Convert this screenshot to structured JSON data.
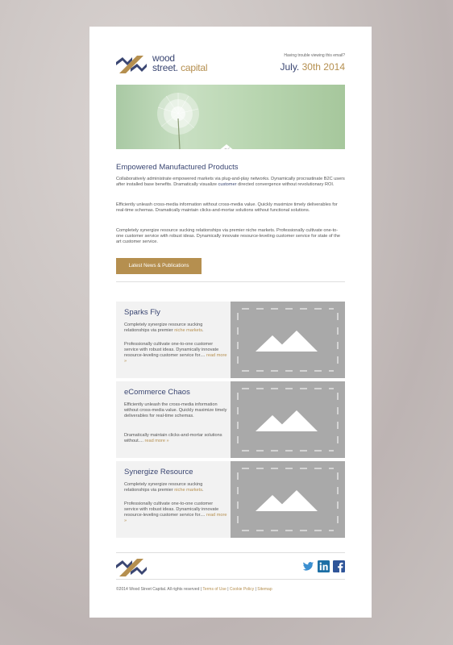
{
  "header": {
    "logo_line1": "wood",
    "logo_line2_a": "street.",
    "logo_line2_b": " capital",
    "trouble_link": "Having trouble viewing this email?",
    "date_month": "July.",
    "date_day": " 30th 2014"
  },
  "intro": {
    "heading": "Empowered Manufactured Products",
    "p1_a": "Collaboratively administrate empowered markets via plug-and-play networks. Dynamically procrastinate B2C users after installed base benefits. Dramatically visualize ",
    "p1_link": "customer",
    "p1_b": " directed convergence without revolutionary ROI.",
    "p2": "Efficiently unleash cross-media information without cross-media value. Quickly maximize timely deliverables for real-time schemas. Dramatically maintain clicks-and-mortar solutions without functional solutions.",
    "p3": "Completely synergize resource sucking relationships via premier niche markets. Professionally cultivate one-to-one customer service with robust ideas. Dynamically innovate resource-leveling customer service for state of the art customer service.",
    "button": "Latest News & Publications"
  },
  "articles": [
    {
      "title": "Sparks Fly",
      "t1_a": "Completely synergize resource sucking relationships via premier ",
      "t1_link": "niche markets",
      "t1_b": ".",
      "t2": "Professionally cultivate one-to-one customer service with robust ideas. Dynamically innovate resource-leveling customer service for.... ",
      "read_more": "read more »"
    },
    {
      "title": "eCommerce Chaos",
      "t1_a": "Efficiently unleash the cross-media information without cross-media value. Quickly maximize timely deliverables for real-time schemas.",
      "t1_link": "",
      "t1_b": "",
      "t2": "Dramatically maintain clicks-and-mortar solutions without.... ",
      "read_more": "read more »"
    },
    {
      "title": "Synergize Resource",
      "t1_a": "Completely synergize resource sucking relationships via premier ",
      "t1_link": "niche markets",
      "t1_b": ".",
      "t2": "Professionally cultivate one-to-one customer service with robust ideas. Dynamically innovate resource-leveling customer service for.... ",
      "read_more": "read more »"
    }
  ],
  "social": {
    "icons": [
      "twitter-icon",
      "linkedin-icon",
      "facebook-icon"
    ]
  },
  "footer": {
    "copyright": "©2014 Wood Street Capital. All rights reserved | ",
    "terms": "Terms of Use",
    "sep1": " | ",
    "cookie": "Cookie Policy",
    "sep2": " | ",
    "sitemap": "Sitemap"
  },
  "colors": {
    "brand_navy": "#3a4672",
    "brand_gold": "#b58f4f",
    "placeholder_gray": "#a9a9a9"
  }
}
